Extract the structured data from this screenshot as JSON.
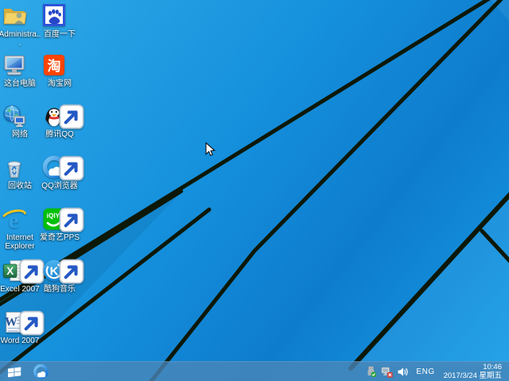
{
  "desktop": {
    "icons": [
      {
        "id": "user-folder",
        "icon": "user-folder-icon",
        "label": "Administra...",
        "col": 0,
        "row": 0,
        "shortcut": false
      },
      {
        "id": "baidu",
        "icon": "baidu-paw-icon",
        "label": "百度一下",
        "col": 1,
        "row": 0,
        "shortcut": false
      },
      {
        "id": "this-pc",
        "icon": "computer-icon",
        "label": "这台电脑",
        "col": 0,
        "row": 1,
        "shortcut": false
      },
      {
        "id": "taobao",
        "icon": "taobao-icon",
        "label": "淘宝网",
        "col": 1,
        "row": 1,
        "shortcut": false
      },
      {
        "id": "network",
        "icon": "network-globe-icon",
        "label": "网络",
        "col": 0,
        "row": 2,
        "shortcut": false
      },
      {
        "id": "tencent-qq",
        "icon": "qq-penguin-icon",
        "label": "腾讯QQ",
        "col": 1,
        "row": 2,
        "shortcut": true
      },
      {
        "id": "recycle-bin",
        "icon": "recycle-bin-icon",
        "label": "回收站",
        "col": 0,
        "row": 3,
        "shortcut": false
      },
      {
        "id": "qq-browser",
        "icon": "qq-browser-icon",
        "label": "QQ浏览器",
        "col": 1,
        "row": 3,
        "shortcut": true
      },
      {
        "id": "internet-explorer",
        "icon": "internet-explorer-icon",
        "label": "Internet Explorer",
        "col": 0,
        "row": 4,
        "shortcut": false
      },
      {
        "id": "iqiyi",
        "icon": "iqiyi-icon",
        "label": "爱奇艺PPS",
        "col": 1,
        "row": 4,
        "shortcut": true
      },
      {
        "id": "excel",
        "icon": "excel-icon",
        "label": "Excel 2007",
        "col": 0,
        "row": 5,
        "shortcut": true
      },
      {
        "id": "kugou",
        "icon": "kugou-music-icon",
        "label": "酷狗音乐",
        "col": 1,
        "row": 5,
        "shortcut": true
      },
      {
        "id": "word",
        "icon": "word-icon",
        "label": "Word 2007",
        "col": 0,
        "row": 6,
        "shortcut": true
      }
    ]
  },
  "taskbar": {
    "language": "ENG",
    "clock": {
      "time": "10:46",
      "date": "2017/3/24 星期五"
    },
    "tray_icons": [
      "usb-safely-remove-icon",
      "network-disconnected-icon",
      "volume-icon"
    ]
  },
  "colors": {
    "wallpaper_top_left": "#2fa9e8",
    "wallpaper_mid": "#1590dc",
    "wallpaper_deep": "#0e7ccd",
    "wallpaper_bottom_right": "#179ce6",
    "beam": "#0d1806",
    "taskbar": "rgba(74,134,184,0.80)",
    "icon_label": "#ffffff"
  }
}
